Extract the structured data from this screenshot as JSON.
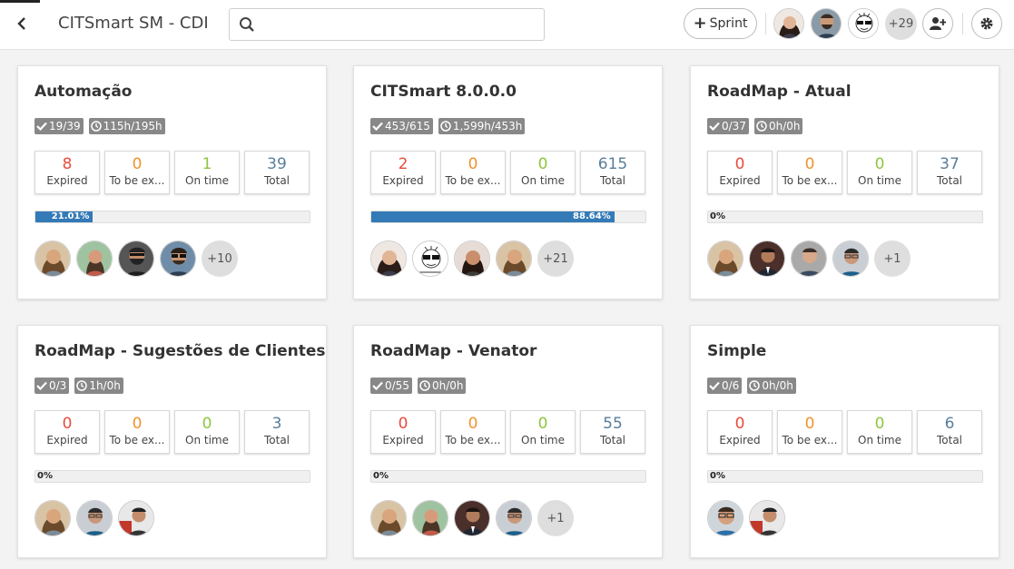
{
  "app": {
    "title": "CITSmart SM - CDI"
  },
  "search": {
    "placeholder": "",
    "value": ""
  },
  "toolbar": {
    "sprint_label": "Sprint",
    "more_members": "+29"
  },
  "colors": {
    "expired": "#e94b3c",
    "to_be_expired": "#f0932b",
    "on_time": "#8dc63f",
    "total": "#5a7d9a",
    "progress": "#337ab7"
  },
  "stat_labels": {
    "expired": "Expired",
    "to_be_expired": "To be ex...",
    "on_time": "On time",
    "total": "Total"
  },
  "header_avatars": [
    {
      "icon": "avatar-woman-dark-hair"
    },
    {
      "icon": "avatar-man-beard"
    },
    {
      "icon": "avatar-cartoon-sunglasses"
    }
  ],
  "projects": [
    {
      "title": "Automação",
      "tasks": "19/39",
      "hours": "115h/195h",
      "expired": "8",
      "to_be_expired": "0",
      "on_time": "1",
      "total": "39",
      "progress_label": "21.01%",
      "progress": 0.2101,
      "members": [
        "avatar-woman-1",
        "avatar-woman-2",
        "avatar-man-beard",
        "avatar-man-sunglasses"
      ],
      "more_members": "+10"
    },
    {
      "title": "CITSmart 8.0.0.0",
      "tasks": "453/615",
      "hours": "1,599h/453h",
      "expired": "2",
      "to_be_expired": "0",
      "on_time": "0",
      "total": "615",
      "progress_label": "88.64%",
      "progress": 0.8864,
      "members": [
        "avatar-woman-dark-hair",
        "avatar-cartoon-sunglasses",
        "avatar-woman-3",
        "avatar-woman-1"
      ],
      "more_members": "+21"
    },
    {
      "title": "RoadMap - Atual",
      "tasks": "0/37",
      "hours": "0h/0h",
      "expired": "0",
      "to_be_expired": "0",
      "on_time": "0",
      "total": "37",
      "progress_label": "0%",
      "progress": 0,
      "members": [
        "avatar-woman-1",
        "avatar-man-suit",
        "avatar-man-2",
        "avatar-man-3"
      ],
      "more_members": "+1"
    },
    {
      "title": "RoadMap - Sugestões de Clientes",
      "tasks": "0/3",
      "hours": "1h/0h",
      "expired": "0",
      "to_be_expired": "0",
      "on_time": "0",
      "total": "3",
      "progress_label": "0%",
      "progress": 0,
      "members": [
        "avatar-woman-1",
        "avatar-man-3",
        "avatar-man-4"
      ],
      "more_members": ""
    },
    {
      "title": "RoadMap - Venator",
      "tasks": "0/55",
      "hours": "0h/0h",
      "expired": "0",
      "to_be_expired": "0",
      "on_time": "0",
      "total": "55",
      "progress_label": "0%",
      "progress": 0,
      "members": [
        "avatar-woman-1",
        "avatar-woman-2",
        "avatar-man-suit",
        "avatar-man-3"
      ],
      "more_members": "+1"
    },
    {
      "title": "Simple",
      "tasks": "0/6",
      "hours": "0h/0h",
      "expired": "0",
      "to_be_expired": "0",
      "on_time": "0",
      "total": "6",
      "progress_label": "0%",
      "progress": 0,
      "members": [
        "avatar-man-glasses",
        "avatar-man-4"
      ],
      "more_members": ""
    }
  ]
}
